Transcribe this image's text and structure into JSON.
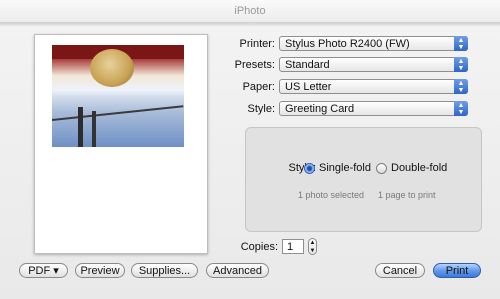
{
  "window": {
    "title": "iPhoto"
  },
  "form": {
    "printer": {
      "label": "Printer:",
      "value": "Stylus Photo R2400 (FW)"
    },
    "presets": {
      "label": "Presets:",
      "value": "Standard"
    },
    "paper": {
      "label": "Paper:",
      "value": "US Letter"
    },
    "style": {
      "label": "Style:",
      "value": "Greeting Card"
    }
  },
  "card_options": {
    "style_label": "Style:",
    "single_fold": "Single-fold",
    "double_fold": "Double-fold",
    "photos_selected": "1 photo selected",
    "pages_to_print": "1 page to print"
  },
  "copies": {
    "label": "Copies:",
    "value": "1"
  },
  "buttons": {
    "pdf": "PDF ▾",
    "preview": "Preview",
    "supplies": "Supplies...",
    "advanced": "Advanced",
    "cancel": "Cancel",
    "print": "Print"
  },
  "colors": {
    "accent": "#3e7ad9"
  }
}
